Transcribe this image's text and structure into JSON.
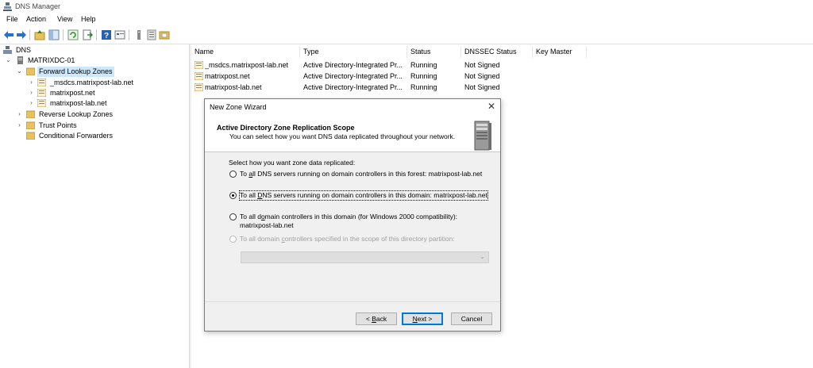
{
  "window": {
    "title": "DNS Manager"
  },
  "menu": [
    "File",
    "Action",
    "View",
    "Help"
  ],
  "toolbar_icons": [
    "back-arrow-icon",
    "forward-arrow-icon",
    "up-folder-icon",
    "show-tree-icon",
    "refresh-icon",
    "export-list-icon",
    "help-icon",
    "properties-icon",
    "zone-icon",
    "host-record-icon",
    "folder-icon"
  ],
  "tree": {
    "root": "DNS",
    "server": "MATRIXDC-01",
    "forward": "Forward Lookup Zones",
    "zones": [
      "_msdcs.matrixpost-lab.net",
      "matrixpost.net",
      "matrixpost-lab.net"
    ],
    "reverse": "Reverse Lookup Zones",
    "trust": "Trust Points",
    "conditional": "Conditional Forwarders"
  },
  "list": {
    "headers": [
      "Name",
      "Type",
      "Status",
      "DNSSEC Status",
      "Key Master"
    ],
    "rows": [
      [
        "_msdcs.matrixpost-lab.net",
        "Active Directory-Integrated Pr...",
        "Running",
        "Not Signed",
        ""
      ],
      [
        "matrixpost.net",
        "Active Directory-Integrated Pr...",
        "Running",
        "Not Signed",
        ""
      ],
      [
        "matrixpost-lab.net",
        "Active Directory-Integrated Pr...",
        "Running",
        "Not Signed",
        ""
      ]
    ]
  },
  "wizard": {
    "title": "New Zone Wizard",
    "close": "✕",
    "heading": "Active Directory Zone Replication Scope",
    "subheading": "You can select how you want DNS data replicated throughout your network.",
    "prompt": "Select how you want zone data replicated:",
    "opt1": {
      "pre": "To ",
      "acc": "a",
      "post": "ll DNS servers running on domain controllers in this forest: matrixpost-lab.net"
    },
    "opt2": {
      "pre": "To all ",
      "acc": "D",
      "post": "NS servers running on domain controllers in this domain: matrixpost-lab.net"
    },
    "opt3": {
      "line1_pre": "To all d",
      "acc": "o",
      "line1_post": "main controllers in this domain (for Windows 2000 compatibility):",
      "line2": "matrixpost-lab.net"
    },
    "opt4": {
      "pre": "To all domain ",
      "acc": "c",
      "post": "ontrollers specified in the scope of this directory partition:"
    },
    "selected_option": 2,
    "partition_value": "",
    "back_pre": "< ",
    "back_acc": "B",
    "back_post": "ack",
    "next_acc": "N",
    "next_post": "ext >",
    "cancel": "Cancel"
  }
}
